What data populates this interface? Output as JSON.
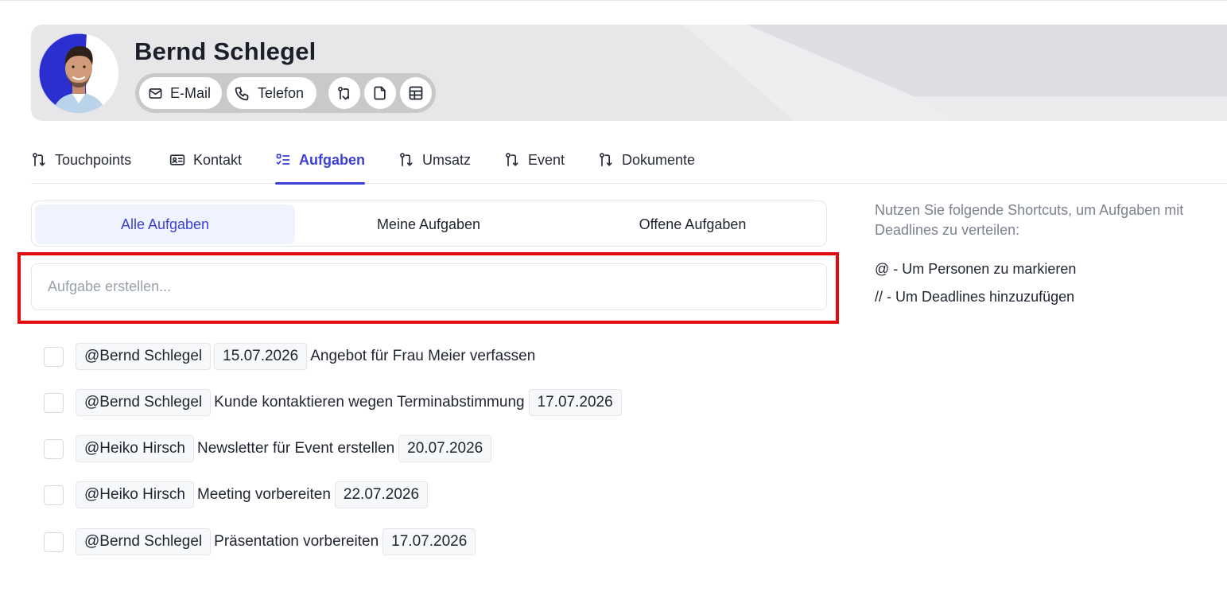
{
  "profile": {
    "name": "Bernd Schlegel",
    "actions": {
      "email_label": "E-Mail",
      "phone_label": "Telefon"
    }
  },
  "tabs": [
    {
      "label": "Touchpoints",
      "icon": "git-pull-request-icon",
      "active": false
    },
    {
      "label": "Kontakt",
      "icon": "id-card-icon",
      "active": false
    },
    {
      "label": "Aufgaben",
      "icon": "checklist-icon",
      "active": true
    },
    {
      "label": "Umsatz",
      "icon": "git-pull-request-icon",
      "active": false
    },
    {
      "label": "Event",
      "icon": "git-pull-request-icon",
      "active": false
    },
    {
      "label": "Dokumente",
      "icon": "git-pull-request-icon",
      "active": false
    }
  ],
  "filters": [
    {
      "label": "Alle Aufgaben",
      "active": true
    },
    {
      "label": "Meine Aufgaben",
      "active": false
    },
    {
      "label": "Offene Aufgaben",
      "active": false
    }
  ],
  "create_task": {
    "placeholder": "Aufgabe erstellen...",
    "value": ""
  },
  "tasks": [
    {
      "person": "@Bernd Schlegel",
      "date": "15.07.2026",
      "text": "Angebot für Frau Meier verfassen",
      "date_first": true,
      "done": false
    },
    {
      "person": "@Bernd Schlegel",
      "date": "17.07.2026",
      "text": "Kunde kontaktieren wegen Terminabstimmung",
      "date_first": false,
      "done": false
    },
    {
      "person": "@Heiko Hirsch",
      "date": "20.07.2026",
      "text": "Newsletter für Event erstellen",
      "date_first": false,
      "done": false
    },
    {
      "person": "@Heiko Hirsch",
      "date": "22.07.2026",
      "text": "Meeting vorbereiten",
      "date_first": false,
      "done": false
    },
    {
      "person": "@Bernd Schlegel",
      "date": "17.07.2026",
      "text": "Präsentation vorbereiten",
      "date_first": false,
      "done": false
    }
  ],
  "hints": {
    "intro": "Nutzen Sie folgende Shortcuts, um Aufgaben mit Deadlines zu verteilen:",
    "shortcut_person": "@ - Um Personen zu markieren",
    "shortcut_deadline": "// - Um Deadlines hinzuzufügen"
  },
  "colors": {
    "accent": "#3b3fd6",
    "highlight": "#e30b0b",
    "avatar_ring": "#2b2fd0"
  }
}
